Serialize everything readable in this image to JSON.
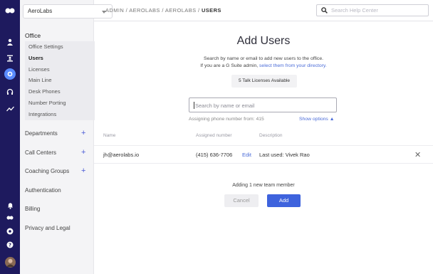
{
  "account": {
    "name": "AeroLabs"
  },
  "breadcrumb": {
    "path": "ADMIN / AEROLABS / AEROLABS / ",
    "current": "USERS"
  },
  "help_search": {
    "placeholder": "Search Help Center"
  },
  "rail": {
    "icons": [
      "dialpad-logo-icon",
      "user-icon",
      "contacts-icon",
      "settings-icon",
      "headset-icon",
      "analytics-icon",
      "notification-icon",
      "dialpad-icon",
      "help-icon",
      "support-icon",
      "avatar"
    ]
  },
  "nav": {
    "office_heading": "Office",
    "office_items": [
      "Office Settings",
      "Users",
      "Licenses",
      "Main Line",
      "Desk Phones",
      "Number Porting",
      "Integrations"
    ],
    "active": "Users",
    "sections": [
      {
        "label": "Departments",
        "has_add": true,
        "add_glyph": "+"
      },
      {
        "label": "Call Centers",
        "has_add": true,
        "add_glyph": "+"
      },
      {
        "label": "Coaching Groups",
        "has_add": true,
        "add_glyph": "+"
      },
      {
        "label": "Authentication",
        "has_add": false
      },
      {
        "label": "Billing",
        "has_add": false
      },
      {
        "label": "Privacy and Legal",
        "has_add": false
      }
    ]
  },
  "main": {
    "title": "Add Users",
    "desc_line1": "Search by name or email to add new users to the office.",
    "desc_line2_prefix": "If you are a G Suite admin,",
    "desc_line2_link": "select them from your directory.",
    "licenses_badge": "5 Talk Licenses Available",
    "search_placeholder": "Search by name or email",
    "assigning_text": "Assigning phone number from: 415",
    "show_options": "Show options ▲",
    "columns": [
      "Name",
      "Assigned number",
      "Description"
    ],
    "rows": [
      {
        "email": "jh@aerolabs.io",
        "number": "(415) 636-7706",
        "edit": "Edit",
        "description": "Last used: Vivek Rao"
      }
    ],
    "adding_text": "Adding 1 new team member",
    "cancel_label": "Cancel",
    "add_label": "Add"
  },
  "colors": {
    "rail": "#1e1a5e",
    "accent": "#3e63dd",
    "link": "#4a6bd8"
  }
}
